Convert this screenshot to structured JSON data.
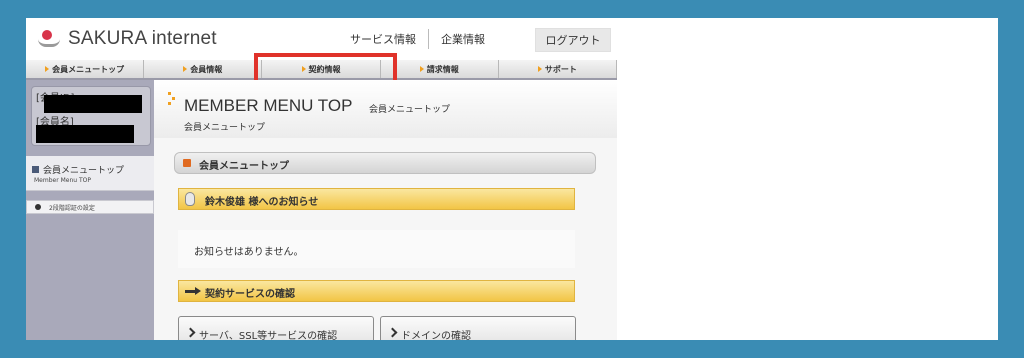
{
  "brand": {
    "name": "SAKURA internet"
  },
  "topnav": {
    "service_info": "サービス情報",
    "company_info": "企業情報",
    "logout": "ログアウト"
  },
  "tabs": [
    {
      "label": "会員メニュートップ"
    },
    {
      "label": "会員情報"
    },
    {
      "label": "契約情報"
    },
    {
      "label": "請求情報"
    },
    {
      "label": "サポート"
    }
  ],
  "highlighted_tab": "契約情報",
  "sidebar": {
    "member_id_label": "[会員ID]",
    "member_name_label": "[会員名]",
    "menu_top_jp": "会員メニュートップ",
    "menu_top_en": "Member Menu TOP",
    "two_factor": "2段階認証の設定"
  },
  "page": {
    "title_en": "MEMBER MENU TOP",
    "title_jp": "会員メニュートップ",
    "subtitle": "会員メニュートップ",
    "section_title": "会員メニュートップ",
    "notice_title": "鈴木俊雄 様へのお知らせ",
    "notice_body": "お知らせはありません。",
    "contract_title": "契約サービスの確認",
    "btn_server": "サーバ、SSL等サービスの確認",
    "btn_domain": "ドメインの確認"
  },
  "colors": {
    "frame": "#3a8cb4",
    "highlight": "#e0322a",
    "accent_orange": "#f0a020",
    "notice_yellow": "#f2c546"
  }
}
